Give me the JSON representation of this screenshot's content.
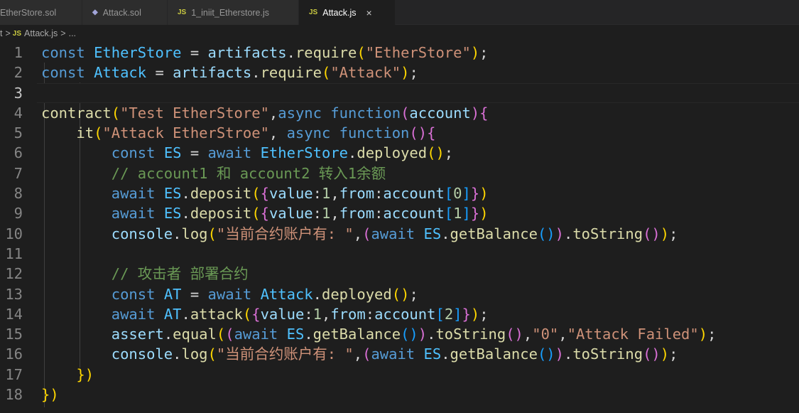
{
  "tabs": [
    {
      "label": "EtherStore.sol",
      "icon": "",
      "active": false
    },
    {
      "label": "Attack.sol",
      "icon": "solidity-icon",
      "active": false
    },
    {
      "label": "1_iniit_Etherstore.js",
      "icon": "js-icon",
      "active": false
    },
    {
      "label": "Attack.js",
      "icon": "js-icon",
      "active": true,
      "close": "×"
    }
  ],
  "breadcrumb": {
    "prefix": "t",
    "sep": ">",
    "file": "Attack.js",
    "more": "..."
  },
  "icon_labels": {
    "js": "JS",
    "sol": "◆"
  },
  "editor": {
    "current_line": 3,
    "line_numbers": [
      "1",
      "2",
      "3",
      "4",
      "5",
      "6",
      "7",
      "8",
      "9",
      "10",
      "11",
      "12",
      "13",
      "14",
      "15",
      "16",
      "17",
      "18"
    ],
    "lines": [
      "const EtherStore = artifacts.require(\"EtherStore\");",
      "const Attack = artifacts.require(\"Attack\");",
      "",
      "contract(\"Test EtherStore\",async function(account){",
      "    it(\"Attack EtherStroe\", async function(){",
      "        const ES = await EtherStore.deployed();",
      "        // account1 和 account2 转入1余额",
      "        await ES.deposit({value:1,from:account[0]})",
      "        await ES.deposit({value:1,from:account[1]})",
      "        console.log(\"当前合约账户有: \",(await ES.getBalance()).toString());",
      "",
      "        // 攻击者 部署合约",
      "        const AT = await Attack.deployed();",
      "        await AT.attack({value:1,from:account[2]});",
      "        assert.equal((await ES.getBalance()).toString(),\"0\",\"Attack Failed\");",
      "        console.log(\"当前合约账户有: \",(await ES.getBalance()).toString());",
      "    })",
      "})"
    ]
  },
  "colors": {
    "background": "#1e1e1e",
    "keyword": "#569cd6",
    "string": "#ce9178",
    "comment": "#6a9955",
    "function": "#dcdcaa"
  }
}
